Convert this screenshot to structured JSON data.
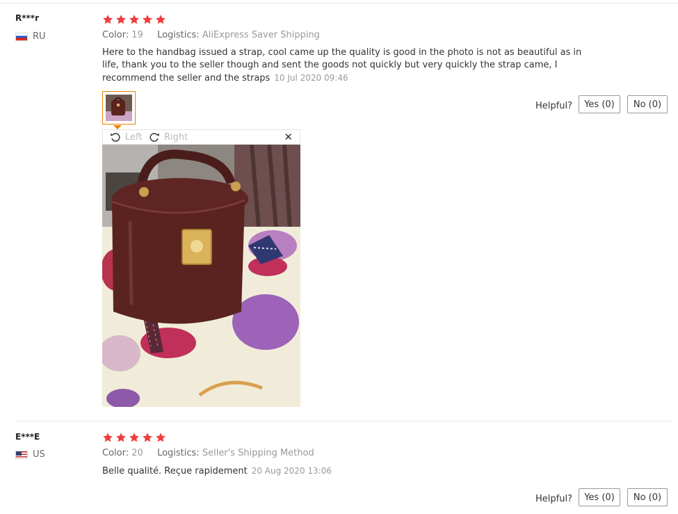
{
  "reviews": [
    {
      "user": "R***r",
      "country": "RU",
      "rating": 5,
      "color_label": "Color:",
      "color_value": "19",
      "logistics_label": "Logistics:",
      "logistics_value": "AliExpress Saver Shipping",
      "text": "Here to the handbag issued a strap, cool came up the quality is good in the photo is not as beautiful as in life, thank you to the seller though and sent the goods not quickly but very quickly the strap came, I recommend the seller and the straps",
      "date": "10 Jul 2020 09:46",
      "helpful_label": "Helpful?",
      "yes_label": "Yes (0)",
      "no_label": "No (0)"
    },
    {
      "user": "E***E",
      "country": "US",
      "rating": 5,
      "color_label": "Color:",
      "color_value": "20",
      "logistics_label": "Logistics:",
      "logistics_value": "Seller's Shipping Method",
      "text": "Belle qualité. Reçue rapidement",
      "date": "20 Aug 2020 13:06",
      "helpful_label": "Helpful?",
      "yes_label": "Yes (0)",
      "no_label": "No (0)"
    }
  ],
  "viewer": {
    "rotate_left_label": "Left",
    "rotate_right_label": "Right",
    "close_icon": "close-icon"
  },
  "colors": {
    "star": "#f03e3e",
    "thumb_border": "#f08200"
  }
}
